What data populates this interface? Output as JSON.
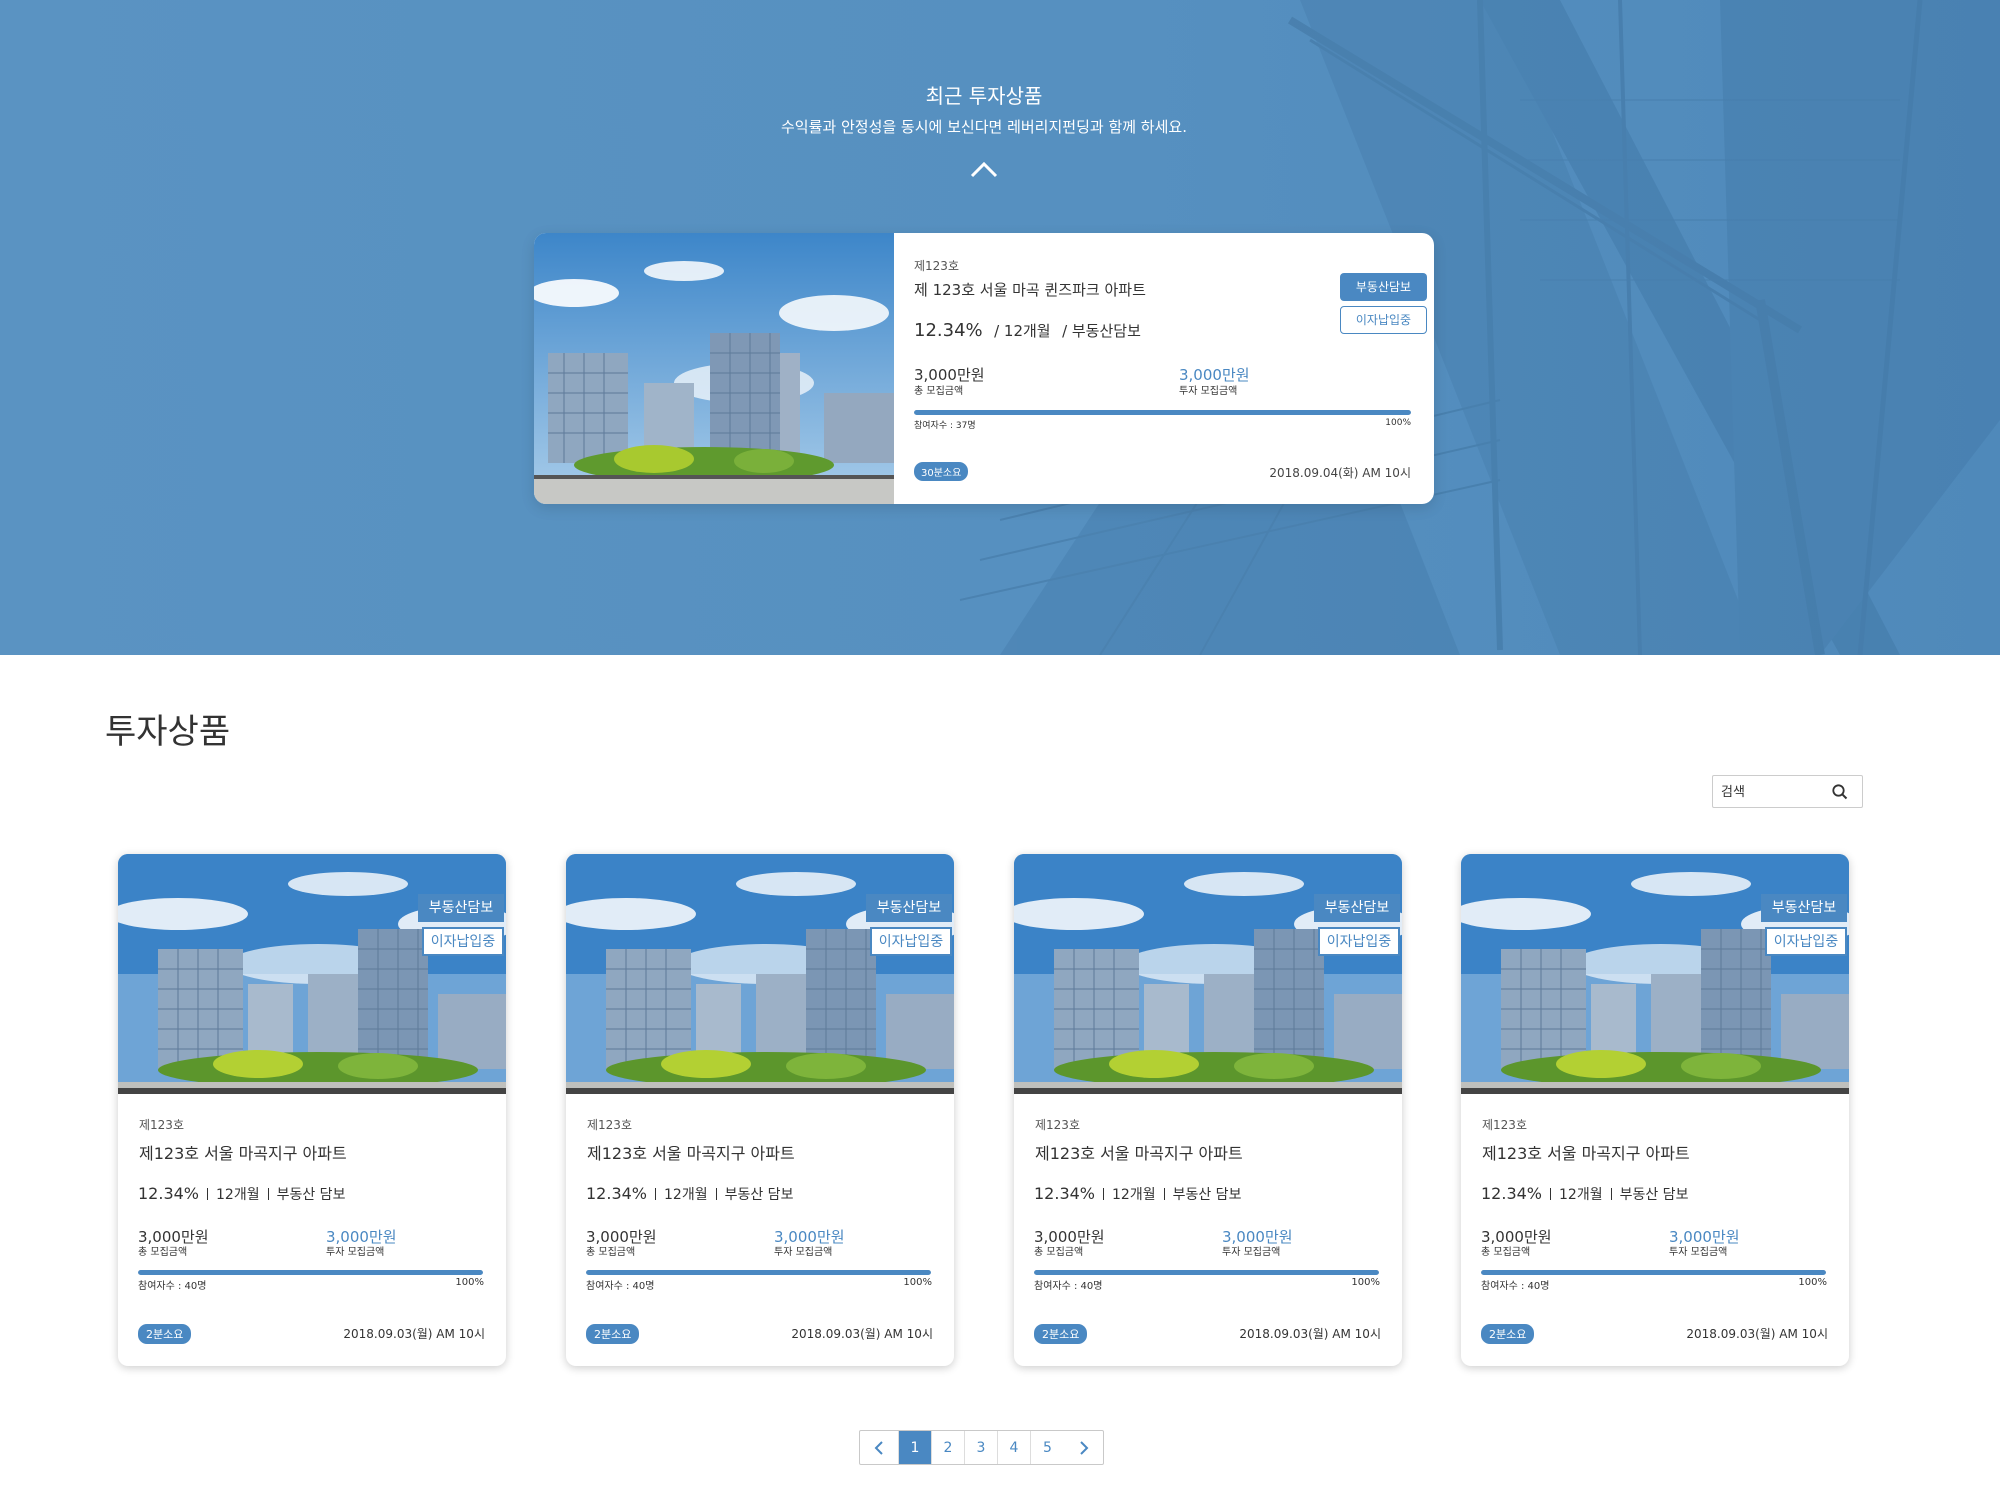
{
  "hero": {
    "title": "최근 투자상품",
    "subtitle": "수익률과 안정성을 동시에 보신다면 레버리지펀딩과 함께 하세요.",
    "featured": {
      "number": "제123호",
      "name": "제 123호 서울 마곡 퀸즈파크 아파트",
      "rate": "12.34%",
      "period": "/ 12개월",
      "type": "/ 부동산담보",
      "total_amount": "3,000만원",
      "total_label": "총 모집금액",
      "invest_amount": "3,000만원",
      "invest_label": "투자 모집금액",
      "progress": 1.0,
      "participants": "참여자수 : 37명",
      "percent": "100%",
      "duration": "30분소요",
      "date": "2018.09.04(화) AM 10시",
      "tag_primary": "부동산담보",
      "tag_secondary": "이자납입중"
    }
  },
  "section": {
    "title": "투자상품",
    "search_placeholder": "검색",
    "search_icon": "search-icon"
  },
  "cards": [
    {
      "tag_primary": "부동산담보",
      "tag_secondary": "이자납입중",
      "number": "제123호",
      "name": "제123호 서울 마곡지구 아파트",
      "rate": "12.34%",
      "period": "12개월",
      "type": "부동산 담보",
      "total_amount": "3,000만원",
      "total_label": "총 모집금액",
      "invest_amount": "3,000만원",
      "invest_label": "투자 모집금액",
      "progress": 1.0,
      "participants": "참여자수 : 40명",
      "percent": "100%",
      "duration": "2분소요",
      "date": "2018.09.03(월) AM 10시"
    },
    {
      "tag_primary": "부동산담보",
      "tag_secondary": "이자납입중",
      "number": "제123호",
      "name": "제123호 서울 마곡지구 아파트",
      "rate": "12.34%",
      "period": "12개월",
      "type": "부동산 담보",
      "total_amount": "3,000만원",
      "total_label": "총 모집금액",
      "invest_amount": "3,000만원",
      "invest_label": "투자 모집금액",
      "progress": 1.0,
      "participants": "참여자수 : 40명",
      "percent": "100%",
      "duration": "2분소요",
      "date": "2018.09.03(월) AM 10시"
    },
    {
      "tag_primary": "부동산담보",
      "tag_secondary": "이자납입중",
      "number": "제123호",
      "name": "제123호 서울 마곡지구 아파트",
      "rate": "12.34%",
      "period": "12개월",
      "type": "부동산 담보",
      "total_amount": "3,000만원",
      "total_label": "총 모집금액",
      "invest_amount": "3,000만원",
      "invest_label": "투자 모집금액",
      "progress": 1.0,
      "participants": "참여자수 : 40명",
      "percent": "100%",
      "duration": "2분소요",
      "date": "2018.09.03(월) AM 10시"
    },
    {
      "tag_primary": "부동산담보",
      "tag_secondary": "이자납입중",
      "number": "제123호",
      "name": "제123호 서울 마곡지구 아파트",
      "rate": "12.34%",
      "period": "12개월",
      "type": "부동산 담보",
      "total_amount": "3,000만원",
      "total_label": "총 모집금액",
      "invest_amount": "3,000만원",
      "invest_label": "투자 모집금액",
      "progress": 1.0,
      "participants": "참여자수 : 40명",
      "percent": "100%",
      "duration": "2분소요",
      "date": "2018.09.03(월) AM 10시"
    }
  ],
  "pagination": {
    "pages": [
      "1",
      "2",
      "3",
      "4",
      "5"
    ],
    "active": "1",
    "prev_icon": "chevron-left-icon",
    "next_icon": "chevron-right-icon"
  },
  "colors": {
    "accent": "#4a88c2",
    "hero_bg": "#5891c0"
  }
}
